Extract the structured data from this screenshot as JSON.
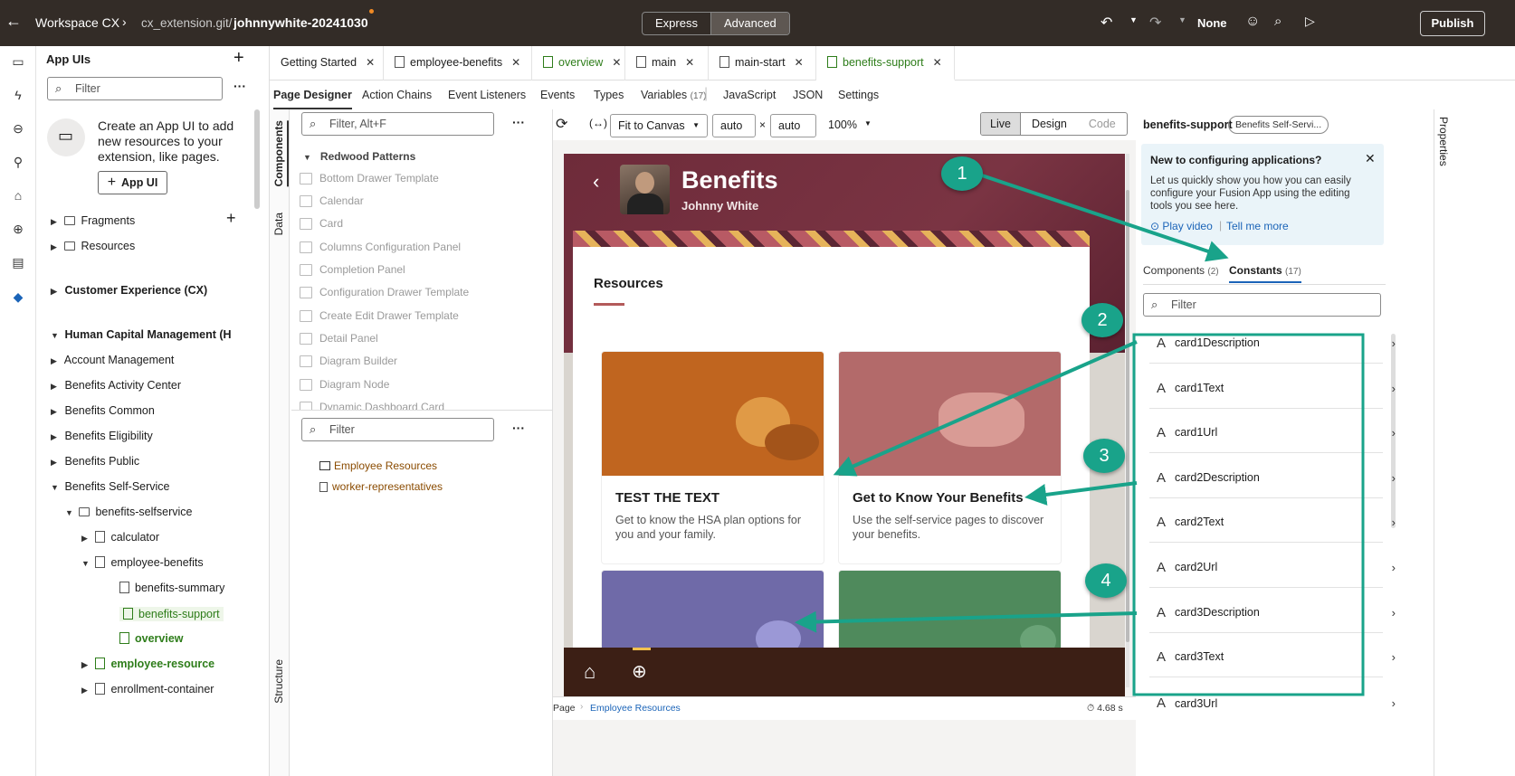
{
  "topbar": {
    "back_icon": "arrow-left-icon",
    "workspace": "Workspace CX",
    "repo": "cx_extension.git/",
    "branch": "johnnywhite-20241030",
    "mode_express": "Express",
    "mode_advanced": "Advanced",
    "undo_icon": "undo-icon",
    "redo_icon": "redo-icon",
    "none_label": "None",
    "publish": "Publish"
  },
  "nav": {
    "title": "App UIs",
    "filter_placeholder": "Filter",
    "promo_text": "Create an App UI to add new resources to your extension, like pages.",
    "promo_button": "App UI",
    "fragments": "Fragments",
    "resources": "Resources",
    "cx": "Customer Experience (CX)",
    "hcm": "Human Capital Management (H",
    "items": [
      "Account Management",
      "Benefits Activity Center",
      "Benefits Common",
      "Benefits Eligibility",
      "Benefits Public",
      "Benefits Self-Service"
    ],
    "selfservice": "benefits-selfservice",
    "calculator": "calculator",
    "employee_benefits": "employee-benefits",
    "benefits_summary": "benefits-summary",
    "benefits_support": "benefits-support",
    "overview": "overview",
    "employee_resource": "employee-resource",
    "enrollment_container": "enrollment-container"
  },
  "tabs": [
    "Getting Started",
    "employee-benefits",
    "overview",
    "main",
    "main-start",
    "benefits-support"
  ],
  "subtabs": {
    "page_designer": "Page Designer",
    "action_chains": "Action Chains",
    "event_listeners": "Event Listeners",
    "events": "Events",
    "types": "Types",
    "variables": "Variables",
    "variables_count": "(17)",
    "javascript": "JavaScript",
    "json": "JSON",
    "settings": "Settings"
  },
  "components": {
    "vtab_components": "Components",
    "vtab_data": "Data",
    "vtab_structure": "Structure",
    "filter_placeholder": "Filter, Alt+F",
    "group": "Redwood Patterns",
    "items": [
      "Bottom Drawer Template",
      "Calendar",
      "Card",
      "Columns Configuration Panel",
      "Completion Panel",
      "Configuration Drawer Template",
      "Create Edit Drawer Template",
      "Detail Panel",
      "Diagram Builder",
      "Diagram Node",
      "Dynamic Dashboard Card"
    ],
    "filter2_placeholder": "Filter",
    "structure_items": [
      "Employee Resources",
      "worker-representatives"
    ]
  },
  "canvas": {
    "fit": "Fit to Canvas",
    "w": "auto",
    "h": "auto",
    "zoom": "100%",
    "live": "Live",
    "design": "Design",
    "code": "Code",
    "breadcrumb_page": "Page",
    "breadcrumb_current": "Employee Resources",
    "time": "4.68 s"
  },
  "app": {
    "title": "Benefits",
    "user": "Johnny White",
    "resources": "Resources",
    "card1_title": "TEST THE TEXT",
    "card1_desc": "Get to know the HSA plan options for you and your family.",
    "card2_title": "Get to Know Your Benefits",
    "card2_desc": "Use the self-service pages to discover your benefits."
  },
  "right": {
    "page_name": "benefits-support",
    "badge": "Benefits Self-Servi...",
    "banner_title": "New to configuring applications?",
    "banner_text": "Let us quickly show you how you can easily configure your Fusion App using the editing tools you see here.",
    "play_video": "Play video",
    "tell_more": "Tell me more",
    "tab_components": "Components",
    "tab_components_count": "(2)",
    "tab_constants": "Constants",
    "tab_constants_count": "(17)",
    "filter_placeholder": "Filter",
    "constants": [
      "card1Description",
      "card1Text",
      "card1Url",
      "card2Description",
      "card2Text",
      "card2Url",
      "card3Description",
      "card3Text",
      "card3Url"
    ],
    "properties": "Properties"
  },
  "callouts": [
    "1",
    "2",
    "3",
    "4"
  ],
  "colors": {
    "callout": "#19a38a",
    "app_header": "#6e2b3a",
    "bottom_nav": "#3c1f15",
    "card1": "#c0651f",
    "card2": "#b36a6a",
    "card3": "#6f6aa8",
    "card4": "#4f8a5c",
    "accent_green": "#2e7d1a"
  }
}
